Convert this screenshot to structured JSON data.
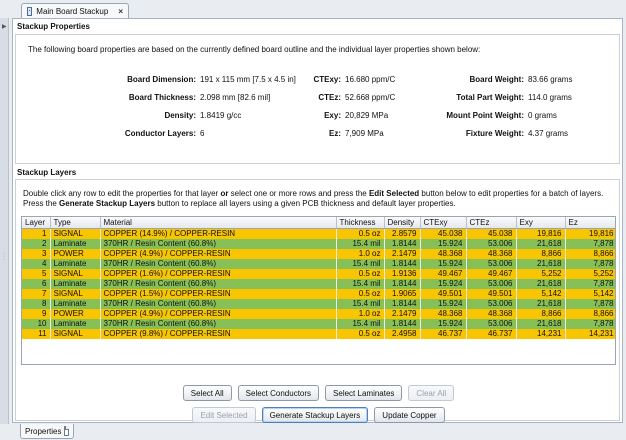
{
  "tab": {
    "title": "Main Board Stackup",
    "close": "×"
  },
  "stackup_properties": {
    "title": "Stackup Properties",
    "intro": "The following board properties are based on the currently defined board outline and the individual layer properties shown below:",
    "col1": [
      {
        "key": "Board Dimension:",
        "value": "191 x 115 mm  [7.5 x 4.5 in]"
      },
      {
        "key": "Board Thickness:",
        "value": "2.098 mm  [82.6 mil]"
      },
      {
        "key": "Density:",
        "value": "1.8419 g/cc"
      },
      {
        "key": "Conductor Layers:",
        "value": "6"
      }
    ],
    "col2": [
      {
        "key": "CTExy:",
        "value": "16.680 ppm/C"
      },
      {
        "key": "CTEz:",
        "value": "52.668 ppm/C"
      },
      {
        "key": "Exy:",
        "value": "20,829 MPa"
      },
      {
        "key": "Ez:",
        "value": "7,909 MPa"
      }
    ],
    "col3": [
      {
        "key": "Board Weight:",
        "value": "83.66 grams"
      },
      {
        "key": "Total Part Weight:",
        "value": "114.0 grams"
      },
      {
        "key": "Mount Point Weight:",
        "value": "0 grams"
      },
      {
        "key": "Fixture Weight:",
        "value": "4.37 grams"
      }
    ]
  },
  "stackup_layers": {
    "title": "Stackup Layers",
    "instructions": {
      "line1_a": "Double click any row to edit the properties for that layer ",
      "line1_or": "or",
      "line1_b": " select one or more rows and press the ",
      "line1_edit": "Edit Selected",
      "line1_c": " button below to edit properties for a batch of layers.",
      "line2_a": "Press the ",
      "line2_gen": "Generate Stackup Layers",
      "line2_b": " button to replace all layers using a given PCB thickness and default layer properties."
    },
    "columns": [
      "Layer",
      "Type",
      "Material",
      "Thickness",
      "Density",
      "CTExy",
      "CTEz",
      "Exy",
      "Ez"
    ],
    "rows": [
      {
        "layer": "1",
        "type": "SIGNAL",
        "material": "COPPER (14.9%) / COPPER-RESIN",
        "thickness": "0.5 oz",
        "density": "2.8579",
        "ctexy": "45.038",
        "ctez": "45.038",
        "exy": "19,816",
        "ez": "19,816",
        "kind": "cond"
      },
      {
        "layer": "2",
        "type": "Laminate",
        "material": "370HR / Resin Content (60.8%)",
        "thickness": "15.4 mil",
        "density": "1.8144",
        "ctexy": "15.924",
        "ctez": "53.006",
        "exy": "21,618",
        "ez": "7,878",
        "kind": "lam"
      },
      {
        "layer": "3",
        "type": "POWER",
        "material": "COPPER (4.9%) / COPPER-RESIN",
        "thickness": "1.0 oz",
        "density": "2.1479",
        "ctexy": "48.368",
        "ctez": "48.368",
        "exy": "8,866",
        "ez": "8,866",
        "kind": "cond"
      },
      {
        "layer": "4",
        "type": "Laminate",
        "material": "370HR / Resin Content (60.8%)",
        "thickness": "15.4 mil",
        "density": "1.8144",
        "ctexy": "15.924",
        "ctez": "53.006",
        "exy": "21,618",
        "ez": "7,878",
        "kind": "lam"
      },
      {
        "layer": "5",
        "type": "SIGNAL",
        "material": "COPPER (1.6%) / COPPER-RESIN",
        "thickness": "0.5 oz",
        "density": "1.9136",
        "ctexy": "49.467",
        "ctez": "49.467",
        "exy": "5,252",
        "ez": "5,252",
        "kind": "cond"
      },
      {
        "layer": "6",
        "type": "Laminate",
        "material": "370HR / Resin Content (60.8%)",
        "thickness": "15.4 mil",
        "density": "1.8144",
        "ctexy": "15.924",
        "ctez": "53.006",
        "exy": "21,618",
        "ez": "7,878",
        "kind": "lam"
      },
      {
        "layer": "7",
        "type": "SIGNAL",
        "material": "COPPER (1.5%) / COPPER-RESIN",
        "thickness": "0.5 oz",
        "density": "1.9065",
        "ctexy": "49.501",
        "ctez": "49.501",
        "exy": "5,142",
        "ez": "5,142",
        "kind": "cond"
      },
      {
        "layer": "8",
        "type": "Laminate",
        "material": "370HR / Resin Content (60.8%)",
        "thickness": "15.4 mil",
        "density": "1.8144",
        "ctexy": "15.924",
        "ctez": "53.006",
        "exy": "21,618",
        "ez": "7,878",
        "kind": "lam"
      },
      {
        "layer": "9",
        "type": "POWER",
        "material": "COPPER (4.9%) / COPPER-RESIN",
        "thickness": "1.0 oz",
        "density": "2.1479",
        "ctexy": "48.368",
        "ctez": "48.368",
        "exy": "8,866",
        "ez": "8,866",
        "kind": "cond"
      },
      {
        "layer": "10",
        "type": "Laminate",
        "material": "370HR / Resin Content (60.8%)",
        "thickness": "15.4 mil",
        "density": "1.8144",
        "ctexy": "15.924",
        "ctez": "53.006",
        "exy": "21,618",
        "ez": "7,878",
        "kind": "lam"
      },
      {
        "layer": "11",
        "type": "SIGNAL",
        "material": "COPPER (9.8%) / COPPER-RESIN",
        "thickness": "0.5 oz",
        "density": "2.4958",
        "ctexy": "46.737",
        "ctez": "46.737",
        "exy": "14,231",
        "ez": "14,231",
        "kind": "cond"
      }
    ],
    "buttons": {
      "select_all": "Select All",
      "select_conductors": "Select Conductors",
      "select_laminates": "Select Laminates",
      "clear_all": "Clear All",
      "edit_selected": "Edit Selected",
      "generate": "Generate Stackup Layers",
      "update_copper": "Update Copper"
    }
  },
  "bottom_tab": {
    "label": "Properties"
  },
  "colors": {
    "conductor_row": "#f9c400",
    "laminate_row": "#86c057"
  }
}
